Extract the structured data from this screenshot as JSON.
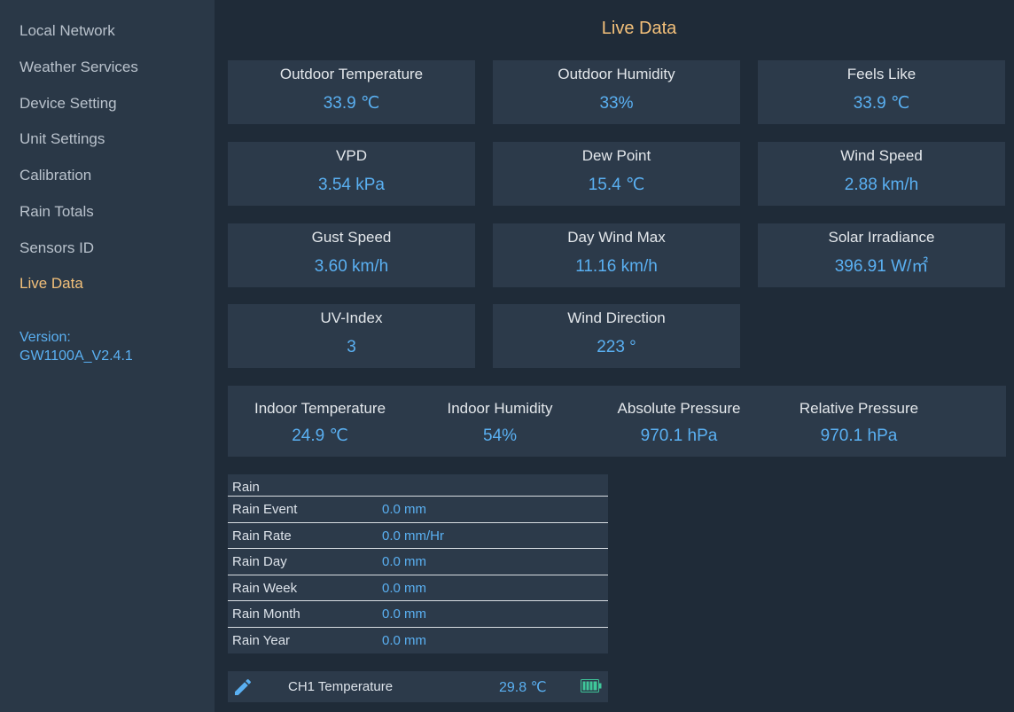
{
  "sidebar": {
    "items": [
      {
        "label": "Local Network"
      },
      {
        "label": "Weather Services"
      },
      {
        "label": "Device Setting"
      },
      {
        "label": "Unit Settings"
      },
      {
        "label": "Calibration"
      },
      {
        "label": "Rain Totals"
      },
      {
        "label": "Sensors ID"
      },
      {
        "label": "Live Data",
        "active": true
      }
    ],
    "version_label": "Version:",
    "version_value": "GW1100A_V2.4.1"
  },
  "main": {
    "title": "Live Data",
    "cards": [
      {
        "label": "Outdoor Temperature",
        "value": "33.9 ℃"
      },
      {
        "label": "Outdoor Humidity",
        "value": "33%"
      },
      {
        "label": "Feels Like",
        "value": "33.9 ℃"
      },
      {
        "label": "VPD",
        "value": "3.54 kPa"
      },
      {
        "label": "Dew Point",
        "value": "15.4 ℃"
      },
      {
        "label": "Wind Speed",
        "value": "2.88 km/h"
      },
      {
        "label": "Gust Speed",
        "value": "3.60 km/h"
      },
      {
        "label": "Day Wind Max",
        "value": "11.16 km/h"
      },
      {
        "label": "Solar Irradiance",
        "value": "396.91 W/㎡"
      },
      {
        "label": "UV-Index",
        "value": "3"
      },
      {
        "label": "Wind Direction",
        "value": "223 °"
      }
    ],
    "indoor": [
      {
        "label": "Indoor Temperature",
        "value": "24.9 ℃"
      },
      {
        "label": "Indoor Humidity",
        "value": "54%"
      },
      {
        "label": "Absolute Pressure",
        "value": "970.1 hPa"
      },
      {
        "label": "Relative Pressure",
        "value": "970.1 hPa"
      }
    ],
    "rain": {
      "header": "Rain",
      "rows": [
        {
          "label": "Rain Event",
          "value": "0.0 mm"
        },
        {
          "label": "Rain Rate",
          "value": "0.0 mm/Hr"
        },
        {
          "label": "Rain Day",
          "value": "0.0 mm"
        },
        {
          "label": "Rain Week",
          "value": "0.0 mm"
        },
        {
          "label": "Rain Month",
          "value": "0.0 mm"
        },
        {
          "label": "Rain Year",
          "value": "0.0 mm"
        }
      ]
    },
    "channel": {
      "label": "CH1 Temperature",
      "value": "29.8 ℃",
      "icons": {
        "edit": "pencil-icon",
        "battery": "battery-full-icon"
      },
      "battery_color": "#3fc79a"
    }
  },
  "colors": {
    "accent": "#f3c07a",
    "value": "#5ab0f2",
    "background": "#1f2b38",
    "sidebar": "#2a3847",
    "card": "#2c3a4a"
  }
}
